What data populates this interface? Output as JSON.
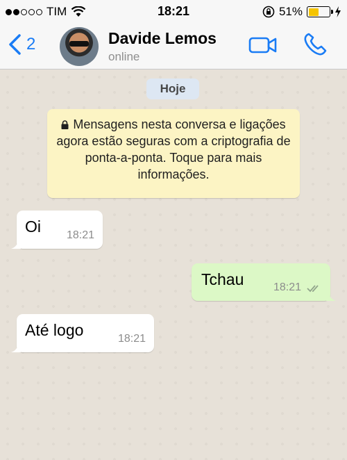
{
  "status_bar": {
    "carrier": "TIM",
    "time": "18:21",
    "battery": "51%",
    "battery_level": 0.51
  },
  "header": {
    "back_count": "2",
    "contact_name": "Davide Lemos",
    "contact_status": "online"
  },
  "chat": {
    "date_chip": "Hoje",
    "notice": "Mensagens nesta conversa e ligações agora estão seguras com a criptografia de ponta-a-ponta. Toque para mais informações.",
    "messages": [
      {
        "direction": "in",
        "text": "Oi",
        "time": "18:21"
      },
      {
        "direction": "out",
        "text": "Tchau",
        "time": "18:21"
      },
      {
        "direction": "in",
        "text": "Até logo",
        "time": "18:21"
      }
    ]
  },
  "colors": {
    "accent": "#1a7cf5",
    "incoming_bubble": "#ffffff",
    "outgoing_bubble": "#dcf8c6",
    "notice_bg": "#fcf4c4"
  },
  "icons": [
    "signal-icon",
    "wifi-icon",
    "lock-rotation-icon",
    "battery-icon",
    "charging-icon",
    "back-chevron-icon",
    "video-call-icon",
    "phone-icon",
    "lock-icon",
    "double-check-icon"
  ]
}
